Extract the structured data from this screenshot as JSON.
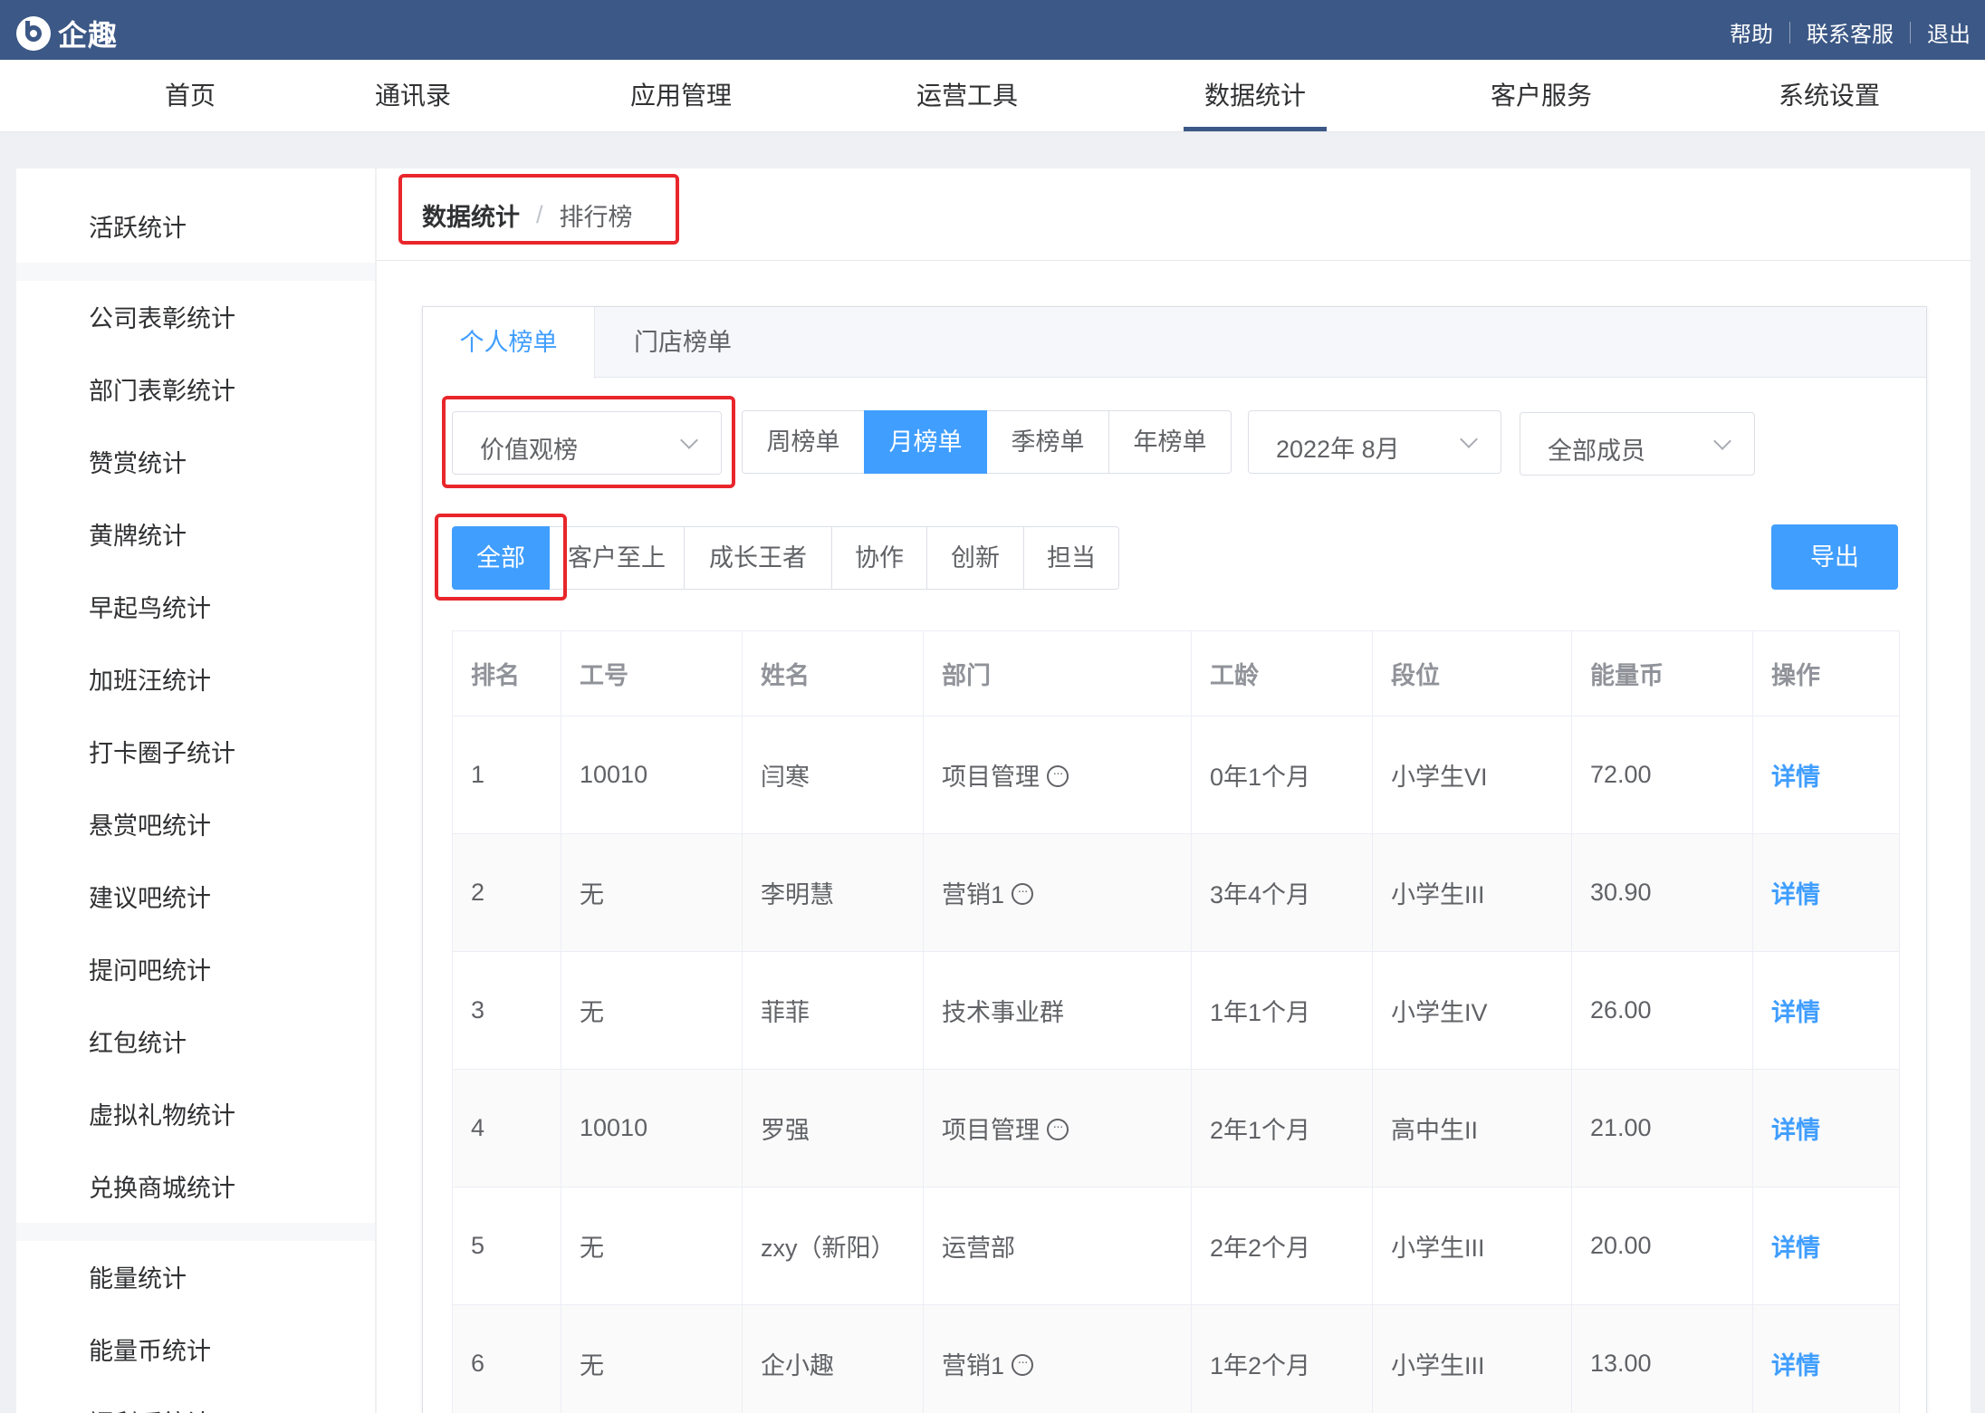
{
  "app": {
    "name": "企趣"
  },
  "top_links": [
    "帮助",
    "联系客服",
    "退出"
  ],
  "nav": {
    "items": [
      "首页",
      "通讯录",
      "应用管理",
      "运营工具",
      "数据统计",
      "客户服务",
      "系统设置"
    ],
    "active": "数据统计"
  },
  "sidebar": {
    "groups": [
      [
        "活跃统计"
      ],
      [
        "公司表彰统计",
        "部门表彰统计",
        "赞赏统计",
        "黄牌统计",
        "早起鸟统计",
        "加班汪统计",
        "打卡圈子统计",
        "悬赏吧统计",
        "建议吧统计",
        "提问吧统计",
        "红包统计",
        "虚拟礼物统计",
        "兑换商城统计"
      ],
      [
        "能量统计",
        "能量币统计",
        "福利币统计"
      ]
    ]
  },
  "breadcrumb": {
    "root": "数据统计",
    "sep": "/",
    "current": "排行榜"
  },
  "tabs": {
    "items": [
      "个人榜单",
      "门店榜单"
    ],
    "active": "个人榜单"
  },
  "filters": {
    "board_type": "价值观榜",
    "periods": [
      "周榜单",
      "月榜单",
      "季榜单",
      "年榜单"
    ],
    "period_active": "月榜单",
    "month": "2022年 8月",
    "members": "全部成员",
    "values": [
      "全部",
      "客户至上",
      "成长王者",
      "协作",
      "创新",
      "担当"
    ],
    "value_active": "全部"
  },
  "export_label": "导出",
  "table": {
    "headers": [
      "排名",
      "工号",
      "姓名",
      "部门",
      "工龄",
      "段位",
      "能量币",
      "操作"
    ],
    "rows": [
      {
        "rank": "1",
        "id": "10010",
        "name": "闫寒",
        "dept": "项目管理",
        "dept_more": true,
        "tenure": "0年1个月",
        "level": "小学生VI",
        "coins": "72.00",
        "action": "详情"
      },
      {
        "rank": "2",
        "id": "无",
        "name": "李明慧",
        "dept": "营销1",
        "dept_more": true,
        "tenure": "3年4个月",
        "level": "小学生III",
        "coins": "30.90",
        "action": "详情"
      },
      {
        "rank": "3",
        "id": "无",
        "name": "菲菲",
        "dept": "技术事业群",
        "dept_more": false,
        "tenure": "1年1个月",
        "level": "小学生IV",
        "coins": "26.00",
        "action": "详情"
      },
      {
        "rank": "4",
        "id": "10010",
        "name": "罗强",
        "dept": "项目管理",
        "dept_more": true,
        "tenure": "2年1个月",
        "level": "高中生II",
        "coins": "21.00",
        "action": "详情"
      },
      {
        "rank": "5",
        "id": "无",
        "name": "zxy（新阳）",
        "dept": "运营部",
        "dept_more": false,
        "tenure": "2年2个月",
        "level": "小学生III",
        "coins": "20.00",
        "action": "详情"
      },
      {
        "rank": "6",
        "id": "无",
        "name": "企小趣",
        "dept": "营销1",
        "dept_more": true,
        "tenure": "1年2个月",
        "level": "小学生III",
        "coins": "13.00",
        "action": "详情"
      }
    ]
  },
  "colors": {
    "topbar": "#3c5886",
    "primary": "#409eff",
    "highlight": "#e8262b"
  }
}
